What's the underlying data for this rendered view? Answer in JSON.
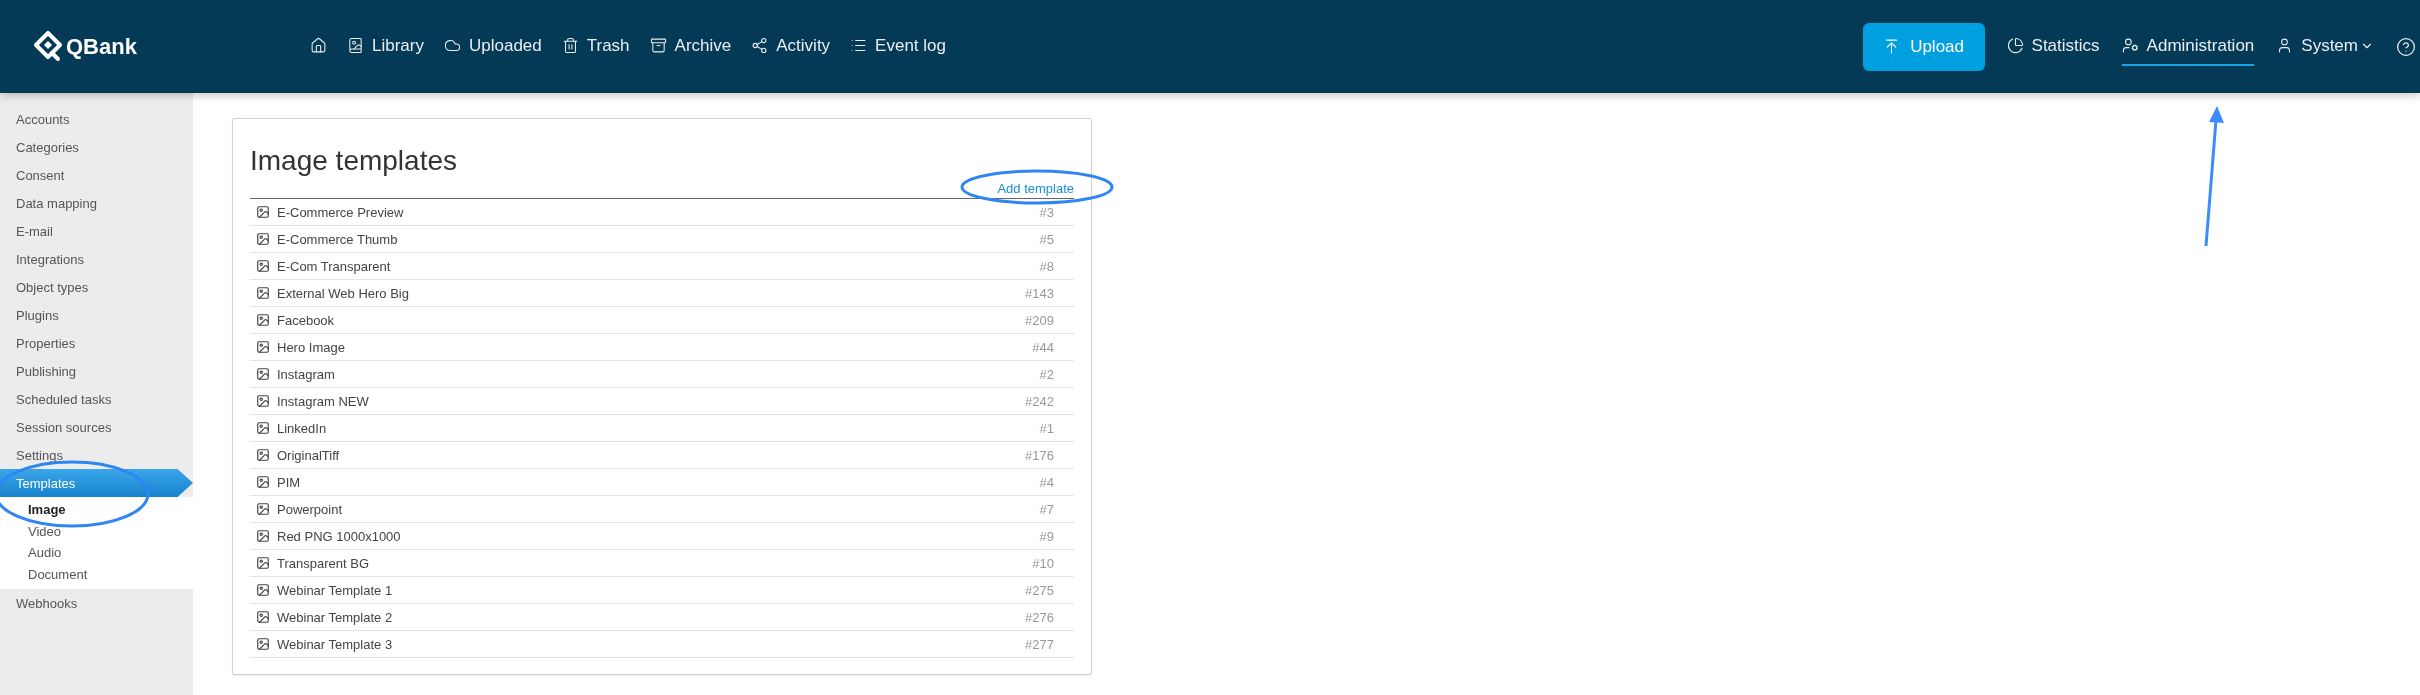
{
  "header": {
    "logo": "QBank",
    "nav": [
      {
        "kind": "home"
      },
      {
        "kind": "library",
        "label": "Library"
      },
      {
        "kind": "uploaded",
        "label": "Uploaded"
      },
      {
        "kind": "trash",
        "label": "Trash"
      },
      {
        "kind": "archive",
        "label": "Archive"
      },
      {
        "kind": "activity",
        "label": "Activity"
      },
      {
        "kind": "eventlog",
        "label": "Event log"
      }
    ],
    "upload_button": "Upload",
    "right_nav": [
      {
        "kind": "statistics",
        "label": "Statistics",
        "selected": false
      },
      {
        "kind": "administration",
        "label": "Administration",
        "selected": true
      },
      {
        "kind": "system",
        "label": "System",
        "selected": false
      },
      {
        "kind": "help"
      }
    ]
  },
  "sidebar": {
    "items": [
      {
        "label": "Accounts",
        "selected": false
      },
      {
        "label": "Categories",
        "selected": false
      },
      {
        "label": "Consent",
        "selected": false
      },
      {
        "label": "Data mapping",
        "selected": false
      },
      {
        "label": "E-mail",
        "selected": false
      },
      {
        "label": "Integrations",
        "selected": false
      },
      {
        "label": "Object types",
        "selected": false
      },
      {
        "label": "Plugins",
        "selected": false
      },
      {
        "label": "Properties",
        "selected": false
      },
      {
        "label": "Publishing",
        "selected": false
      },
      {
        "label": "Scheduled tasks",
        "selected": false
      },
      {
        "label": "Session sources",
        "selected": false
      },
      {
        "label": "Settings",
        "selected": false
      },
      {
        "label": "Templates",
        "selected": true,
        "children": [
          {
            "label": "Image",
            "selected": true
          },
          {
            "label": "Video",
            "selected": false
          },
          {
            "label": "Audio",
            "selected": false
          },
          {
            "label": "Document",
            "selected": false
          }
        ]
      },
      {
        "label": "Webhooks",
        "selected": false
      }
    ]
  },
  "panel": {
    "title": "Image templates",
    "add_link": "Add template",
    "rows": [
      {
        "name": "E-Commerce Preview",
        "id": "#3"
      },
      {
        "name": "E-Commerce Thumb",
        "id": "#5"
      },
      {
        "name": "E-Com Transparent",
        "id": "#8"
      },
      {
        "name": "External Web Hero Big",
        "id": "#143"
      },
      {
        "name": "Facebook",
        "id": "#209"
      },
      {
        "name": "Hero Image",
        "id": "#44"
      },
      {
        "name": "Instagram",
        "id": "#2"
      },
      {
        "name": "Instagram NEW",
        "id": "#242"
      },
      {
        "name": "LinkedIn",
        "id": "#1"
      },
      {
        "name": "OriginalTiff",
        "id": "#176"
      },
      {
        "name": "PIM",
        "id": "#4"
      },
      {
        "name": "Powerpoint",
        "id": "#7"
      },
      {
        "name": "Red PNG 1000x1000",
        "id": "#9"
      },
      {
        "name": "Transparent BG",
        "id": "#10"
      },
      {
        "name": "Webinar Template 1",
        "id": "#275"
      },
      {
        "name": "Webinar Template 2",
        "id": "#276"
      },
      {
        "name": "Webinar Template 3",
        "id": "#277"
      }
    ]
  }
}
